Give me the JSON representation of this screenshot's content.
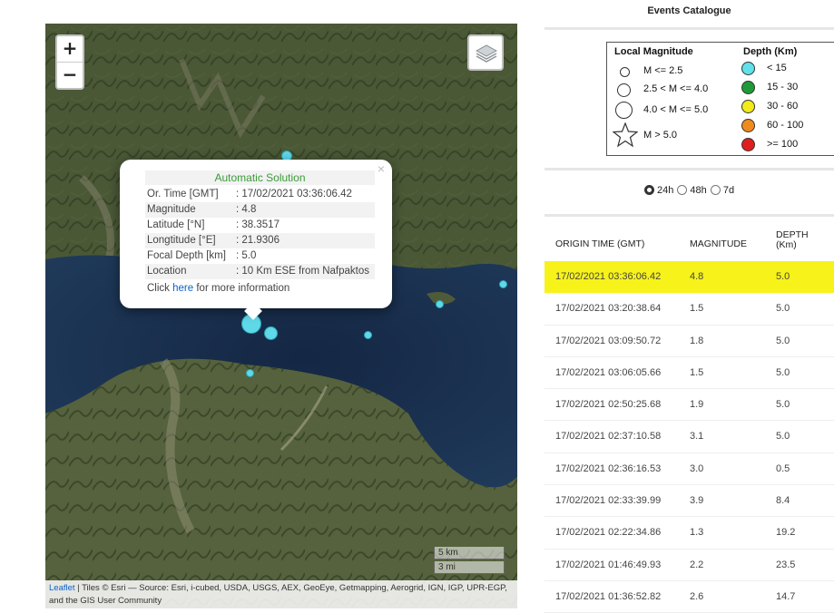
{
  "map": {
    "zoom_in": "+",
    "zoom_out": "−",
    "popup": {
      "title": "Automatic Solution",
      "close": "×",
      "rows": [
        {
          "k": "Or. Time [GMT]",
          "v": ": 17/02/2021 03:36:06.42"
        },
        {
          "k": "Magnitude",
          "v": ": 4.8"
        },
        {
          "k": "Latitude [°N]",
          "v": ": 38.3517"
        },
        {
          "k": "Longtitude [°E]",
          "v": ": 21.9306"
        },
        {
          "k": "Focal Depth [km]",
          "v": ": 5.0"
        },
        {
          "k": "Location",
          "v": ": 10 Km ESE from Nafpaktos"
        }
      ],
      "more_prefix": "Click ",
      "more_link": "here",
      "more_suffix": " for more information"
    },
    "scale_km": "5 km",
    "scale_mi": "3 mi",
    "attribution_link": "Leaflet",
    "attribution_text": " | Tiles © Esri — Source: Esri, i-cubed, USDA, USGS, AEX, GeoEye, Getmapping, Aerogrid, IGN, IGP, UPR-EGP, and the GIS User Community",
    "event_color": "#5fd8e8"
  },
  "panel": {
    "title": "Events Catalogue",
    "legend": {
      "mag_header": "Local Magnitude",
      "depth_header": "Depth (Km)",
      "mag": [
        "M <= 2.5",
        "2.5 < M <= 4.0",
        "4.0 < M <= 5.0",
        "M > 5.0"
      ],
      "depth": [
        {
          "label": "< 15",
          "color": "#5fe0ea"
        },
        {
          "label": "15 - 30",
          "color": "#1e9a3a"
        },
        {
          "label": "30 - 60",
          "color": "#f2ea1a"
        },
        {
          "label": "60 - 100",
          "color": "#f08a1e"
        },
        {
          "label": ">= 100",
          "color": "#e01e1e"
        }
      ]
    },
    "periods": [
      "24h",
      "48h",
      "7d"
    ],
    "selected_period": "24h",
    "table": {
      "headers": {
        "time": "ORIGIN TIME (GMT)",
        "mag": "MAGNITUDE",
        "depth1": "DEPTH",
        "depth2": "(Km)"
      },
      "rows": [
        {
          "time": "17/02/2021 03:36:06.42",
          "mag": "4.8",
          "depth": "5.0"
        },
        {
          "time": "17/02/2021 03:20:38.64",
          "mag": "1.5",
          "depth": "5.0"
        },
        {
          "time": "17/02/2021 03:09:50.72",
          "mag": "1.8",
          "depth": "5.0"
        },
        {
          "time": "17/02/2021 03:06:05.66",
          "mag": "1.5",
          "depth": "5.0"
        },
        {
          "time": "17/02/2021 02:50:25.68",
          "mag": "1.9",
          "depth": "5.0"
        },
        {
          "time": "17/02/2021 02:37:10.58",
          "mag": "3.1",
          "depth": "5.0"
        },
        {
          "time": "17/02/2021 02:36:16.53",
          "mag": "3.0",
          "depth": "0.5"
        },
        {
          "time": "17/02/2021 02:33:39.99",
          "mag": "3.9",
          "depth": "8.4"
        },
        {
          "time": "17/02/2021 02:22:34.86",
          "mag": "1.3",
          "depth": "19.2"
        },
        {
          "time": "17/02/2021 01:46:49.93",
          "mag": "2.2",
          "depth": "23.5"
        },
        {
          "time": "17/02/2021 01:36:52.82",
          "mag": "2.6",
          "depth": "14.7"
        }
      ],
      "highlight_color": "#f7f21a"
    }
  }
}
